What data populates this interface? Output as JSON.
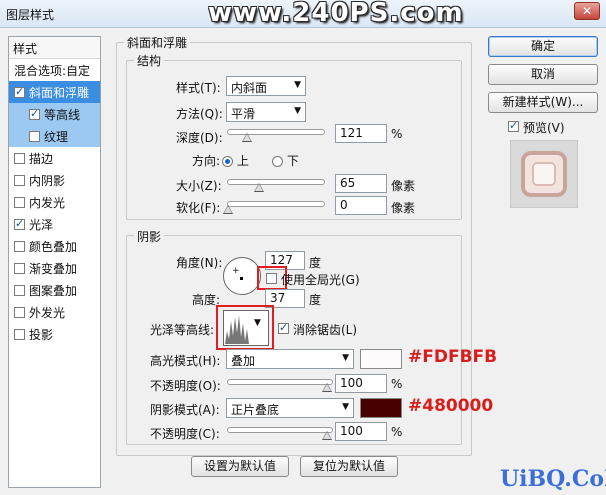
{
  "window": {
    "title": "图层样式",
    "watermark": "www.240PS.com",
    "close_label": "✕"
  },
  "style_list": {
    "header": "样式",
    "blend_options": "混合选项:自定",
    "items": [
      {
        "label": "斜面和浮雕",
        "checked": true,
        "selected": true
      },
      {
        "label": "等高线",
        "checked": true,
        "sub": true
      },
      {
        "label": "纹理",
        "checked": false,
        "sub": true
      },
      {
        "label": "描边",
        "checked": false
      },
      {
        "label": "内阴影",
        "checked": false
      },
      {
        "label": "内发光",
        "checked": false
      },
      {
        "label": "光泽",
        "checked": true
      },
      {
        "label": "颜色叠加",
        "checked": false
      },
      {
        "label": "渐变叠加",
        "checked": false
      },
      {
        "label": "图案叠加",
        "checked": false
      },
      {
        "label": "外发光",
        "checked": false
      },
      {
        "label": "投影",
        "checked": false
      }
    ]
  },
  "bevel": {
    "group_title": "斜面和浮雕",
    "structure_title": "结构",
    "style_label": "样式(T):",
    "style_value": "内斜面",
    "technique_label": "方法(Q):",
    "technique_value": "平滑",
    "depth_label": "深度(D):",
    "depth_value": "121",
    "depth_unit": "%",
    "direction_label": "方向:",
    "direction_up": "上",
    "direction_down": "下",
    "size_label": "大小(Z):",
    "size_value": "65",
    "size_unit": "像素",
    "soften_label": "软化(F):",
    "soften_value": "0",
    "soften_unit": "像素"
  },
  "shading": {
    "group_title": "阴影",
    "angle_label": "角度(N):",
    "angle_value": "127",
    "angle_unit": "度",
    "global_light_label": "使用全局光(G)",
    "altitude_label": "高度:",
    "altitude_value": "37",
    "altitude_unit": "度",
    "gloss_contour_label": "光泽等高线:",
    "antialiased_label": "消除锯齿(L)",
    "highlight_mode_label": "高光模式(H):",
    "highlight_mode_value": "叠加",
    "highlight_color": "#FDFBFB",
    "highlight_hex_note": "#FDFBFB",
    "highlight_opacity_label": "不透明度(O):",
    "highlight_opacity_value": "100",
    "highlight_opacity_unit": "%",
    "shadow_mode_label": "阴影模式(A):",
    "shadow_mode_value": "正片叠底",
    "shadow_color": "#480000",
    "shadow_hex_note": "#480000",
    "shadow_opacity_label": "不透明度(C):",
    "shadow_opacity_value": "100",
    "shadow_opacity_unit": "%"
  },
  "buttons": {
    "ok": "确定",
    "cancel": "取消",
    "new_style": "新建样式(W)...",
    "preview": "预览(V)",
    "make_default": "设置为默认值",
    "reset_default": "复位为默认值"
  },
  "footer_watermark": "UiBQ.CoM"
}
